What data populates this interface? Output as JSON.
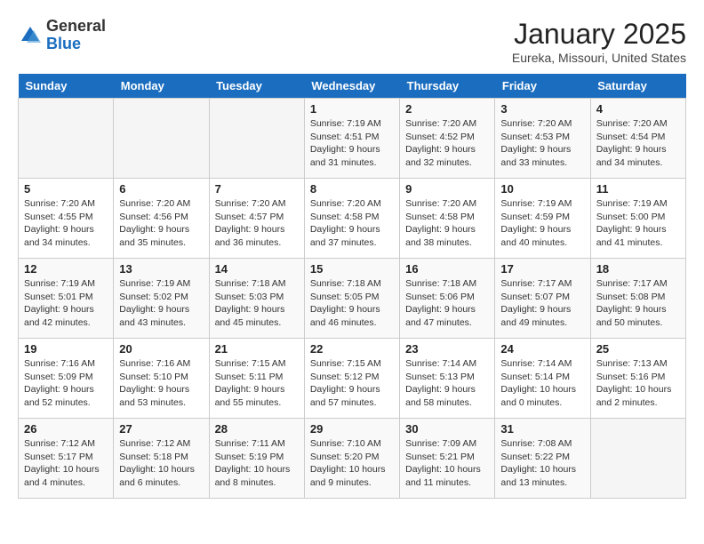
{
  "header": {
    "logo_general": "General",
    "logo_blue": "Blue",
    "title": "January 2025",
    "subtitle": "Eureka, Missouri, United States"
  },
  "days_of_week": [
    "Sunday",
    "Monday",
    "Tuesday",
    "Wednesday",
    "Thursday",
    "Friday",
    "Saturday"
  ],
  "weeks": [
    [
      {
        "day": "",
        "sunrise": "",
        "sunset": "",
        "daylight": ""
      },
      {
        "day": "",
        "sunrise": "",
        "sunset": "",
        "daylight": ""
      },
      {
        "day": "",
        "sunrise": "",
        "sunset": "",
        "daylight": ""
      },
      {
        "day": "1",
        "sunrise": "Sunrise: 7:19 AM",
        "sunset": "Sunset: 4:51 PM",
        "daylight": "Daylight: 9 hours and 31 minutes."
      },
      {
        "day": "2",
        "sunrise": "Sunrise: 7:20 AM",
        "sunset": "Sunset: 4:52 PM",
        "daylight": "Daylight: 9 hours and 32 minutes."
      },
      {
        "day": "3",
        "sunrise": "Sunrise: 7:20 AM",
        "sunset": "Sunset: 4:53 PM",
        "daylight": "Daylight: 9 hours and 33 minutes."
      },
      {
        "day": "4",
        "sunrise": "Sunrise: 7:20 AM",
        "sunset": "Sunset: 4:54 PM",
        "daylight": "Daylight: 9 hours and 34 minutes."
      }
    ],
    [
      {
        "day": "5",
        "sunrise": "Sunrise: 7:20 AM",
        "sunset": "Sunset: 4:55 PM",
        "daylight": "Daylight: 9 hours and 34 minutes."
      },
      {
        "day": "6",
        "sunrise": "Sunrise: 7:20 AM",
        "sunset": "Sunset: 4:56 PM",
        "daylight": "Daylight: 9 hours and 35 minutes."
      },
      {
        "day": "7",
        "sunrise": "Sunrise: 7:20 AM",
        "sunset": "Sunset: 4:57 PM",
        "daylight": "Daylight: 9 hours and 36 minutes."
      },
      {
        "day": "8",
        "sunrise": "Sunrise: 7:20 AM",
        "sunset": "Sunset: 4:58 PM",
        "daylight": "Daylight: 9 hours and 37 minutes."
      },
      {
        "day": "9",
        "sunrise": "Sunrise: 7:20 AM",
        "sunset": "Sunset: 4:58 PM",
        "daylight": "Daylight: 9 hours and 38 minutes."
      },
      {
        "day": "10",
        "sunrise": "Sunrise: 7:19 AM",
        "sunset": "Sunset: 4:59 PM",
        "daylight": "Daylight: 9 hours and 40 minutes."
      },
      {
        "day": "11",
        "sunrise": "Sunrise: 7:19 AM",
        "sunset": "Sunset: 5:00 PM",
        "daylight": "Daylight: 9 hours and 41 minutes."
      }
    ],
    [
      {
        "day": "12",
        "sunrise": "Sunrise: 7:19 AM",
        "sunset": "Sunset: 5:01 PM",
        "daylight": "Daylight: 9 hours and 42 minutes."
      },
      {
        "day": "13",
        "sunrise": "Sunrise: 7:19 AM",
        "sunset": "Sunset: 5:02 PM",
        "daylight": "Daylight: 9 hours and 43 minutes."
      },
      {
        "day": "14",
        "sunrise": "Sunrise: 7:18 AM",
        "sunset": "Sunset: 5:03 PM",
        "daylight": "Daylight: 9 hours and 45 minutes."
      },
      {
        "day": "15",
        "sunrise": "Sunrise: 7:18 AM",
        "sunset": "Sunset: 5:05 PM",
        "daylight": "Daylight: 9 hours and 46 minutes."
      },
      {
        "day": "16",
        "sunrise": "Sunrise: 7:18 AM",
        "sunset": "Sunset: 5:06 PM",
        "daylight": "Daylight: 9 hours and 47 minutes."
      },
      {
        "day": "17",
        "sunrise": "Sunrise: 7:17 AM",
        "sunset": "Sunset: 5:07 PM",
        "daylight": "Daylight: 9 hours and 49 minutes."
      },
      {
        "day": "18",
        "sunrise": "Sunrise: 7:17 AM",
        "sunset": "Sunset: 5:08 PM",
        "daylight": "Daylight: 9 hours and 50 minutes."
      }
    ],
    [
      {
        "day": "19",
        "sunrise": "Sunrise: 7:16 AM",
        "sunset": "Sunset: 5:09 PM",
        "daylight": "Daylight: 9 hours and 52 minutes."
      },
      {
        "day": "20",
        "sunrise": "Sunrise: 7:16 AM",
        "sunset": "Sunset: 5:10 PM",
        "daylight": "Daylight: 9 hours and 53 minutes."
      },
      {
        "day": "21",
        "sunrise": "Sunrise: 7:15 AM",
        "sunset": "Sunset: 5:11 PM",
        "daylight": "Daylight: 9 hours and 55 minutes."
      },
      {
        "day": "22",
        "sunrise": "Sunrise: 7:15 AM",
        "sunset": "Sunset: 5:12 PM",
        "daylight": "Daylight: 9 hours and 57 minutes."
      },
      {
        "day": "23",
        "sunrise": "Sunrise: 7:14 AM",
        "sunset": "Sunset: 5:13 PM",
        "daylight": "Daylight: 9 hours and 58 minutes."
      },
      {
        "day": "24",
        "sunrise": "Sunrise: 7:14 AM",
        "sunset": "Sunset: 5:14 PM",
        "daylight": "Daylight: 10 hours and 0 minutes."
      },
      {
        "day": "25",
        "sunrise": "Sunrise: 7:13 AM",
        "sunset": "Sunset: 5:16 PM",
        "daylight": "Daylight: 10 hours and 2 minutes."
      }
    ],
    [
      {
        "day": "26",
        "sunrise": "Sunrise: 7:12 AM",
        "sunset": "Sunset: 5:17 PM",
        "daylight": "Daylight: 10 hours and 4 minutes."
      },
      {
        "day": "27",
        "sunrise": "Sunrise: 7:12 AM",
        "sunset": "Sunset: 5:18 PM",
        "daylight": "Daylight: 10 hours and 6 minutes."
      },
      {
        "day": "28",
        "sunrise": "Sunrise: 7:11 AM",
        "sunset": "Sunset: 5:19 PM",
        "daylight": "Daylight: 10 hours and 8 minutes."
      },
      {
        "day": "29",
        "sunrise": "Sunrise: 7:10 AM",
        "sunset": "Sunset: 5:20 PM",
        "daylight": "Daylight: 10 hours and 9 minutes."
      },
      {
        "day": "30",
        "sunrise": "Sunrise: 7:09 AM",
        "sunset": "Sunset: 5:21 PM",
        "daylight": "Daylight: 10 hours and 11 minutes."
      },
      {
        "day": "31",
        "sunrise": "Sunrise: 7:08 AM",
        "sunset": "Sunset: 5:22 PM",
        "daylight": "Daylight: 10 hours and 13 minutes."
      },
      {
        "day": "",
        "sunrise": "",
        "sunset": "",
        "daylight": ""
      }
    ]
  ]
}
